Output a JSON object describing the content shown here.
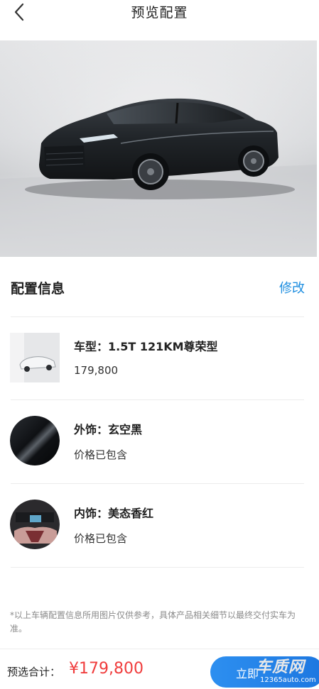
{
  "nav": {
    "title": "预览配置",
    "back_icon": "chevron-left-icon"
  },
  "hero": {
    "image": "black-sedan-photo"
  },
  "config": {
    "section_title": "配置信息",
    "edit_label": "修改",
    "items": [
      {
        "title": "车型：1.5T 121KM尊荣型",
        "sub": "179,800",
        "image": "car-thumbnail"
      },
      {
        "title": "外饰：玄空黑",
        "sub": "价格已包含",
        "image": "exterior-color-swatch",
        "color": "#0f1114"
      },
      {
        "title": "内饰：美态香红",
        "sub": "价格已包含",
        "image": "interior-thumbnail"
      }
    ]
  },
  "disclaimer": "*以上车辆配置信息所用图片仅供参考，具体产品相关细节以最终交付实车为准。",
  "footer": {
    "total_label": "预选合计：",
    "total_price": "¥179,800",
    "cta_label": "立即",
    "accent": "#1e8ee0",
    "price_color": "#f03c3c"
  },
  "watermark": {
    "text": "车质网",
    "url": "12365auto.com"
  }
}
